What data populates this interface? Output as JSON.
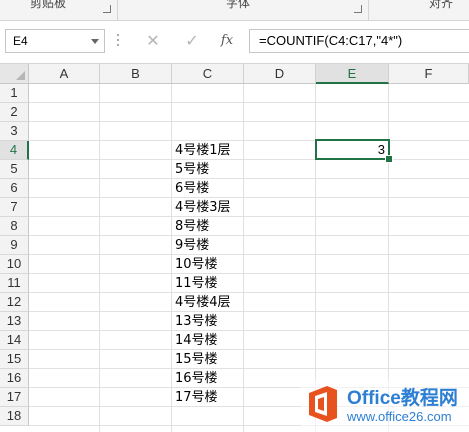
{
  "ribbon": {
    "clipboard_label": "剪贴板",
    "font_label": "字体",
    "align_label": "对齐"
  },
  "formula_bar": {
    "name_box": "E4",
    "cancel_icon": "✕",
    "enter_icon": "✓",
    "fx_icon": "fx",
    "formula": "=COUNTIF(C4:C17,\"4*\")"
  },
  "grid": {
    "columns": [
      "A",
      "B",
      "C",
      "D",
      "E",
      "F"
    ],
    "rows": [
      "1",
      "2",
      "3",
      "4",
      "5",
      "6",
      "7",
      "8",
      "9",
      "10",
      "11",
      "12",
      "13",
      "14",
      "15",
      "16",
      "17",
      "18"
    ],
    "selected_column": "E",
    "selected_row": "4",
    "column_c": [
      "4号楼1层",
      "5号楼",
      "6号楼",
      "4号楼3层",
      "8号楼",
      "9号楼",
      "10号楼",
      "11号楼",
      "4号楼4层",
      "13号楼",
      "14号楼",
      "15号楼",
      "16号楼",
      "17号楼"
    ],
    "e4_value": "3"
  },
  "watermark": {
    "title": "Office教程网",
    "url": "www.office26.com",
    "logo_color": "#e8521f"
  }
}
